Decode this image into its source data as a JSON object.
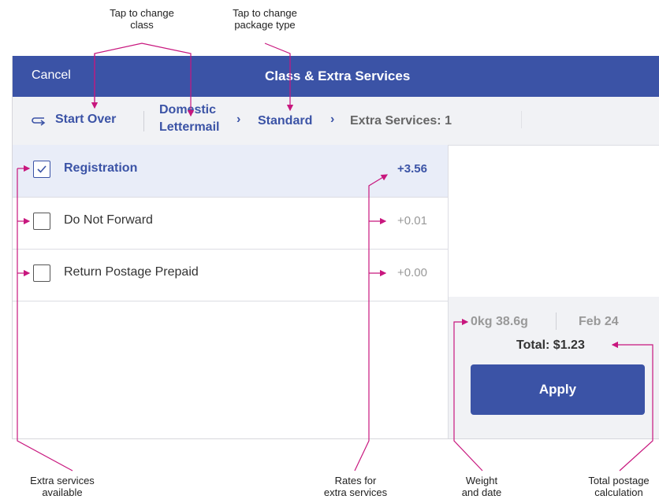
{
  "annotations": {
    "change_class": "Tap to change\nclass",
    "change_package": "Tap to change\npackage type",
    "extra_services": "Extra services\navailable",
    "rates": "Rates for\nextra services",
    "weight_date": "Weight\nand date",
    "total": "Total postage\ncalculation"
  },
  "header": {
    "cancel": "Cancel",
    "title": "Class & Extra Services"
  },
  "breadcrumbs": {
    "start_over": "Start Over",
    "class_line1": "Domestic",
    "class_line2": "Lettermail",
    "package": "Standard",
    "extra": "Extra Services: 1"
  },
  "services": [
    {
      "label": "Registration",
      "rate": "+3.56",
      "checked": true
    },
    {
      "label": "Do Not Forward",
      "rate": "+0.01",
      "checked": false
    },
    {
      "label": "Return Postage Prepaid",
      "rate": "+0.00",
      "checked": false
    }
  ],
  "summary": {
    "weight": "0kg 38.6g",
    "date": "Feb 24",
    "total": "Total: $1.23",
    "apply": "Apply"
  },
  "colors": {
    "brand": "#3b53a6",
    "annotation": "#c8177e"
  }
}
